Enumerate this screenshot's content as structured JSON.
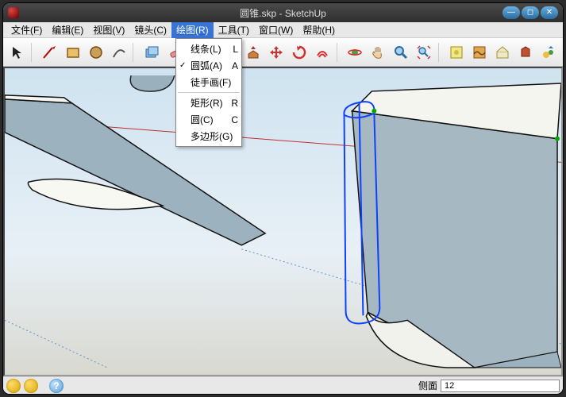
{
  "title": "圆锥.skp - SketchUp",
  "menubar": [
    "文件(F)",
    "编辑(E)",
    "视图(V)",
    "镜头(C)",
    "绘图(R)",
    "工具(T)",
    "窗口(W)",
    "帮助(H)"
  ],
  "menubar_open_index": 4,
  "dropdown": {
    "items": [
      {
        "label": "线条(L)",
        "shortcut": "L",
        "checked": false
      },
      {
        "label": "圆弧(A)",
        "shortcut": "A",
        "checked": true
      },
      {
        "label": "徒手画(F)",
        "shortcut": "",
        "checked": false
      }
    ],
    "items2": [
      {
        "label": "矩形(R)",
        "shortcut": "R",
        "checked": false
      },
      {
        "label": "圆(C)",
        "shortcut": "C",
        "checked": false
      },
      {
        "label": "多边形(G)",
        "shortcut": "",
        "checked": false
      }
    ]
  },
  "toolbar_icons": [
    "select-icon",
    "line-icon",
    "rectangle-icon",
    "circle-icon",
    "arc-icon",
    "make-component-icon",
    "eraser-icon",
    "tape-icon",
    "paint-icon",
    "pushpull-icon",
    "move-icon",
    "rotate-icon",
    "offset-icon",
    "orbit-icon",
    "pan-icon",
    "zoom-icon",
    "zoom-extents-icon",
    "add-location-icon",
    "toggle-terrain-icon",
    "add-building-icon",
    "photo-textures-icon",
    "preview-ge-icon",
    "get-models-icon"
  ],
  "statusbar": {
    "label": "侧面",
    "value": "12"
  }
}
